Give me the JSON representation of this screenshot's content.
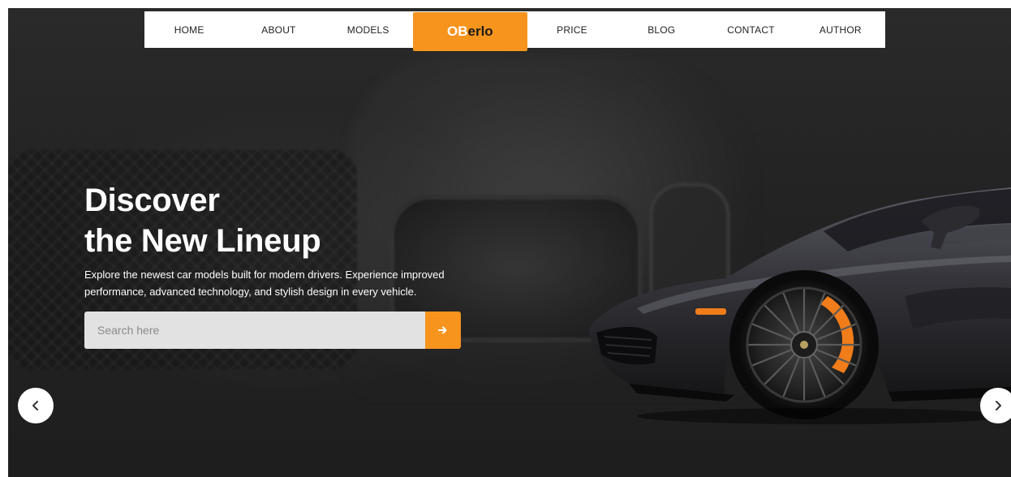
{
  "nav": {
    "items_left": [
      "HOME",
      "ABOUT",
      "MODELS"
    ],
    "logo": {
      "part_a": "OB",
      "part_b": "erlo"
    },
    "items_right": [
      "PRICE",
      "BLOG",
      "CONTACT",
      "AUTHOR"
    ]
  },
  "hero": {
    "title_line1": "Discover",
    "title_line2": "the New Lineup",
    "description": "Explore the newest car models built for modern drivers. Experience improved performance, advanced technology, and stylish design in every vehicle."
  },
  "search": {
    "placeholder": "Search here",
    "button_icon": "arrow-right-icon"
  },
  "slider": {
    "prev_icon": "chevron-left-icon",
    "next_icon": "chevron-right-icon"
  },
  "colors": {
    "accent": "#f7941d",
    "nav_bg": "#ffffff",
    "hero_bg": "#232323",
    "input_bg": "#e2e2e2"
  }
}
